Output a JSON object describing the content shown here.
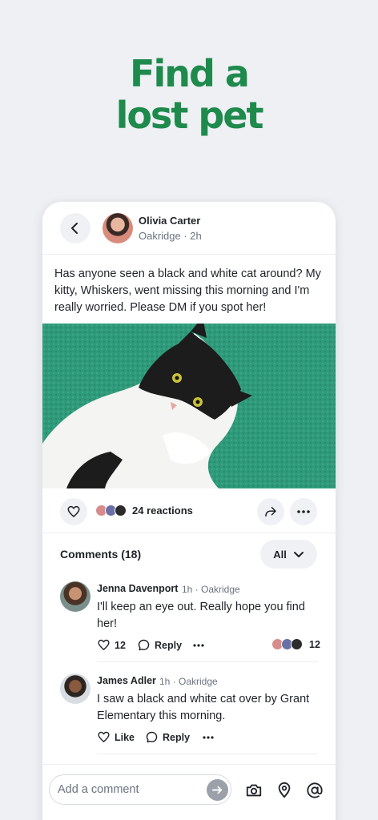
{
  "headline": {
    "line1": "Find a",
    "line2": "lost pet"
  },
  "post": {
    "author": "Olivia Carter",
    "meta": "Oakridge · 2h",
    "text": "Has anyone seen a black and white cat around? My kitty, Whiskers, went missing this morning and I'm really worried. Please DM if you spot her!",
    "reactions_label": "24 reactions"
  },
  "comments_section": {
    "title": "Comments (18)",
    "filter_label": "All"
  },
  "comments": [
    {
      "name": "Jenna Davenport",
      "meta": "1h · Oakridge",
      "text": "I'll keep an eye out. Really hope you find her!",
      "like_label": "12",
      "reply_label": "Reply",
      "reaction_count": "12"
    },
    {
      "name": "James Adler",
      "meta": "1h · Oakridge",
      "text": "I saw a black and white cat over by Grant Elementary this morning.",
      "like_label": "Like",
      "reply_label": "Reply"
    }
  ],
  "composer": {
    "placeholder": "Add a comment"
  },
  "colors": {
    "brand_green": "#1e8a4c",
    "photo_bg": "#2f9a7a"
  },
  "icons": [
    "chevron-left-icon",
    "heart-icon",
    "share-icon",
    "more-icon",
    "chevron-down-icon",
    "comment-icon",
    "arrow-right-icon",
    "camera-icon",
    "location-pin-icon",
    "at-icon"
  ]
}
